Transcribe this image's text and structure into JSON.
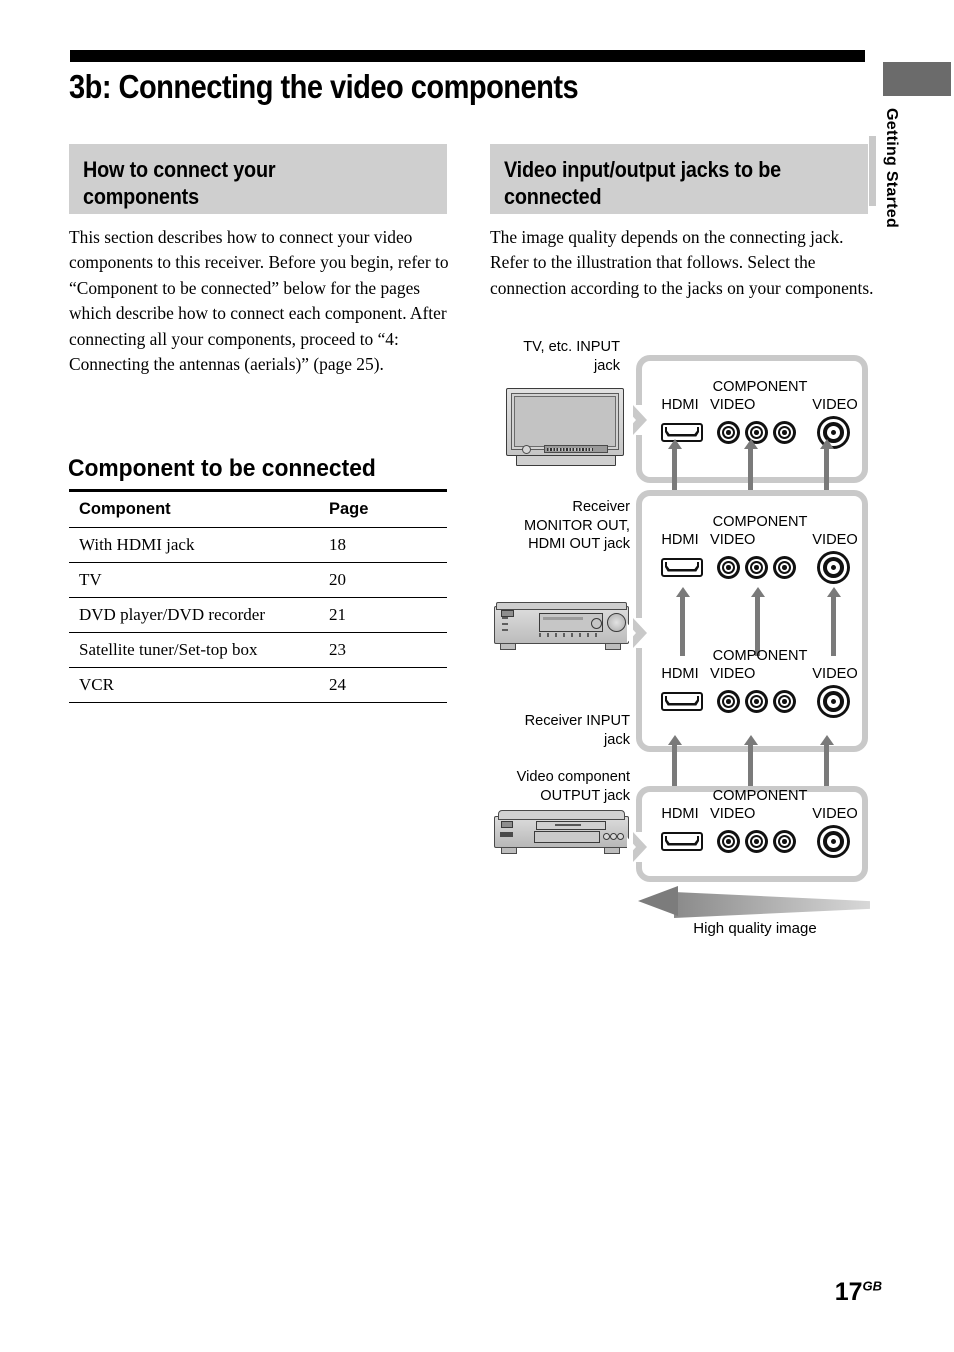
{
  "page": {
    "title": "3b: Connecting the video components",
    "side_tab_label": "Getting Started",
    "folio_number": "17",
    "folio_suffix": "GB"
  },
  "left_column": {
    "section_heading_line1": "How to connect your",
    "section_heading_line2": "components",
    "body": "This section describes how to connect your video components to this receiver. Before you begin, refer to “Component to be connected” below for the pages which describe how to connect each component.\nAfter connecting all your components, proceed to “4: Connecting the antennas (aerials)” (page 25).",
    "table_title": "Component to be connected",
    "table": {
      "headers": [
        "Component",
        "Page"
      ],
      "rows": [
        [
          "With HDMI jack",
          "18"
        ],
        [
          "TV",
          "20"
        ],
        [
          "DVD player/DVD recorder",
          "21"
        ],
        [
          "Satellite tuner/Set-top box",
          "23"
        ],
        [
          "VCR",
          "24"
        ]
      ]
    }
  },
  "right_column": {
    "section_heading_line1": "Video input/output jacks to be",
    "section_heading_line2": "connected",
    "body": "The image quality depends on the connecting jack. Refer to the illustration that follows. Select the connection according to the jacks on your components."
  },
  "diagram": {
    "panels": [
      {
        "device": "tv",
        "label_lines": [
          "TV, etc. INPUT",
          "jack"
        ],
        "jack_labels": {
          "hdmi": "HDMI",
          "component_line1": "COMPONENT",
          "component_line2": "VIDEO",
          "video": "VIDEO"
        }
      },
      {
        "device": "receiver",
        "label_lines": [
          "Receiver",
          "MONITOR OUT,",
          "HDMI OUT jack"
        ],
        "jack_labels": {
          "hdmi": "HDMI",
          "component_line1": "COMPONENT",
          "component_line2": "VIDEO",
          "video": "VIDEO"
        }
      },
      {
        "device": "receiver-input",
        "label_lines": [
          "Receiver INPUT",
          "jack"
        ],
        "jack_labels": {
          "hdmi": "HDMI",
          "component_line1": "COMPONENT",
          "component_line2": "VIDEO",
          "video": "VIDEO"
        }
      },
      {
        "device": "video-component",
        "label_lines": [
          "Video component",
          "OUTPUT jack"
        ],
        "jack_labels": {
          "hdmi": "HDMI",
          "component_line1": "COMPONENT",
          "component_line2": "VIDEO",
          "video": "VIDEO"
        }
      }
    ],
    "quality_arrow_caption": "High quality image"
  },
  "colors": {
    "heading_bar": "#cfcfcf",
    "panel_border": "#c9c9c9",
    "arrow": "#7a7a7a",
    "side_tab": "#6b6b6b"
  }
}
